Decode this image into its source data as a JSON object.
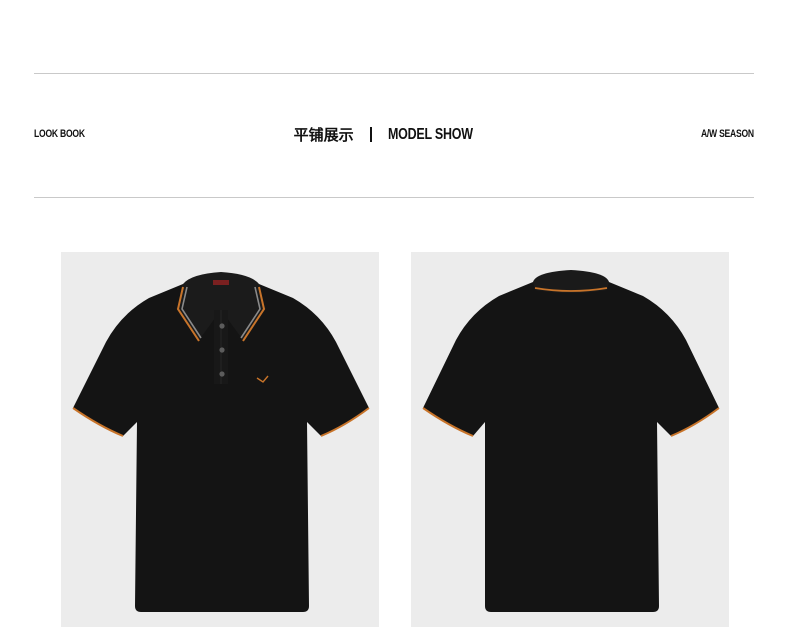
{
  "header": {
    "left_label": "LOOK BOOK",
    "title_cn": "平铺展示",
    "title_en": "MODEL SHOW",
    "right_label": "A/W SEASON"
  },
  "colors": {
    "background": "#ffffff",
    "photo_background": "#ececec",
    "shirt": "#141414",
    "trim": "#c8742a",
    "divider": "#c9c9c9"
  },
  "photos": [
    {
      "view": "front"
    },
    {
      "view": "back"
    }
  ]
}
